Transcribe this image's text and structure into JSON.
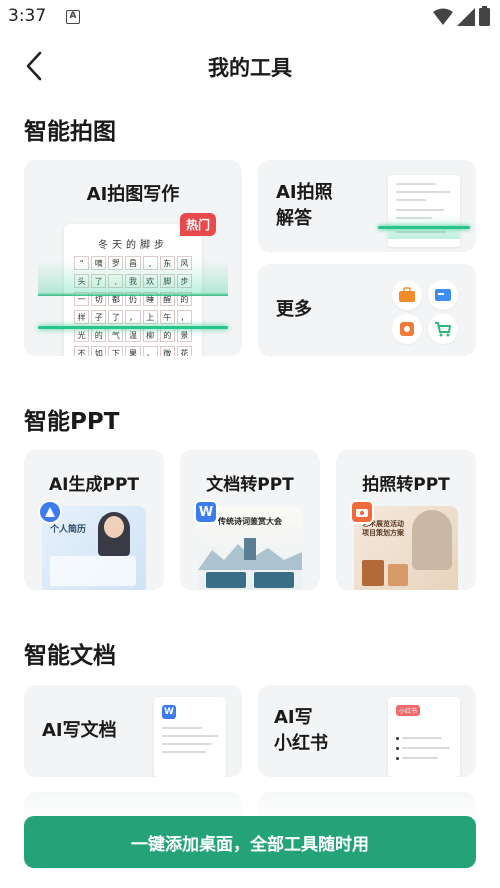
{
  "status_bar": {
    "time": "3:37",
    "notification_glyph": "A"
  },
  "header": {
    "title": "我的工具",
    "back_icon": "chevron-left-icon"
  },
  "sections": {
    "photo": {
      "title": "智能拍图",
      "ai_write": {
        "label": "AI拍图写作",
        "badge": "热门",
        "paper_title": "冬天的脚步",
        "grid_rows": [
          [
            "“",
            "嘀",
            "罗",
            "昌",
            ",",
            "东",
            "风"
          ],
          [
            "头",
            "了",
            ",",
            "我",
            "欢",
            "脚",
            "步"
          ],
          [
            "一",
            "切",
            "都",
            "仍",
            "睡",
            "醒",
            "的"
          ],
          [
            "样",
            "子",
            "了",
            "，",
            "上",
            "午",
            "，"
          ],
          [
            "光",
            "的",
            "气",
            "温",
            "柳",
            "的",
            "景"
          ],
          [
            "不",
            "如",
            "下",
            "果",
            "，",
            "微",
            "花"
          ]
        ]
      },
      "ai_answer": {
        "label_line1": "AI拍照",
        "label_line2": "解答"
      },
      "more": {
        "label": "更多"
      }
    },
    "ppt": {
      "title": "智能PPT",
      "cards": [
        {
          "label": "AI生成PPT",
          "icon": "ai-ppt-icon",
          "preview_text": "个人简历"
        },
        {
          "label": "文档转PPT",
          "icon": "word-icon",
          "icon_glyph": "W",
          "preview_text": "传统诗词鉴赏大会"
        },
        {
          "label": "拍照转PPT",
          "icon": "camera-icon",
          "preview_text": "艺术展览活动项目策划方案"
        }
      ]
    },
    "doc": {
      "title": "智能文档",
      "cards": [
        {
          "label_line1": "AI写文档",
          "label_line2": "",
          "thumb_glyph": "W"
        },
        {
          "label_line1": "AI写",
          "label_line2": "小红书",
          "thumb_tag": "小红书"
        }
      ]
    }
  },
  "bottom_button": {
    "label": "一键添加桌面，全部工具随时用"
  },
  "colors": {
    "accent": "#24a378",
    "card_bg": "#f2f4f5",
    "hot": "#e8494b",
    "word_blue": "#3d7bf0",
    "camera_orange": "#f06a3b"
  }
}
